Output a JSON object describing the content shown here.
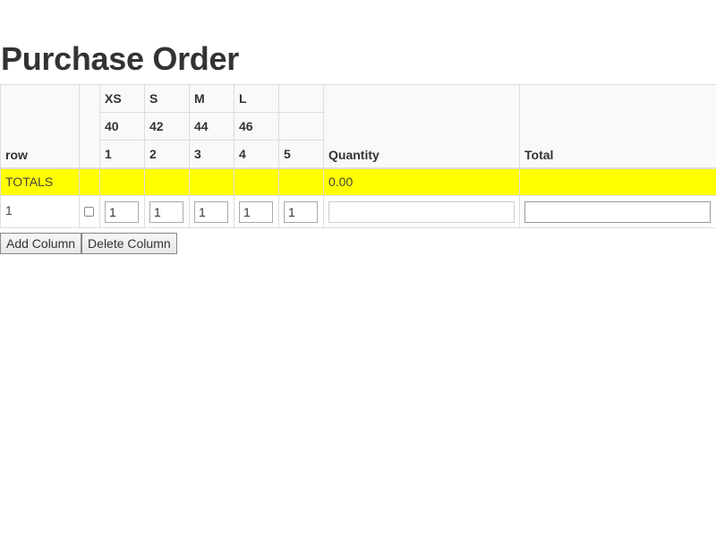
{
  "page": {
    "title": "Purchase Order"
  },
  "table": {
    "header": {
      "row_label": "row",
      "sizes": [
        "XS",
        "S",
        "M",
        "L",
        ""
      ],
      "numbers": [
        "40",
        "42",
        "44",
        "46",
        ""
      ],
      "indexes": [
        "1",
        "2",
        "3",
        "4",
        "5"
      ],
      "quantity_label": "Quantity",
      "total_label": "Total"
    },
    "totals": {
      "label": "TOTALS",
      "quantity": "0.00",
      "highlight_color": "#ffff00"
    },
    "rows": [
      {
        "row_number": "1",
        "checked": false,
        "values": [
          "1",
          "1",
          "1",
          "1",
          "1"
        ],
        "quantity": "",
        "total": ""
      }
    ]
  },
  "buttons": {
    "add_column": "Add Column",
    "delete_column": "Delete Column"
  }
}
